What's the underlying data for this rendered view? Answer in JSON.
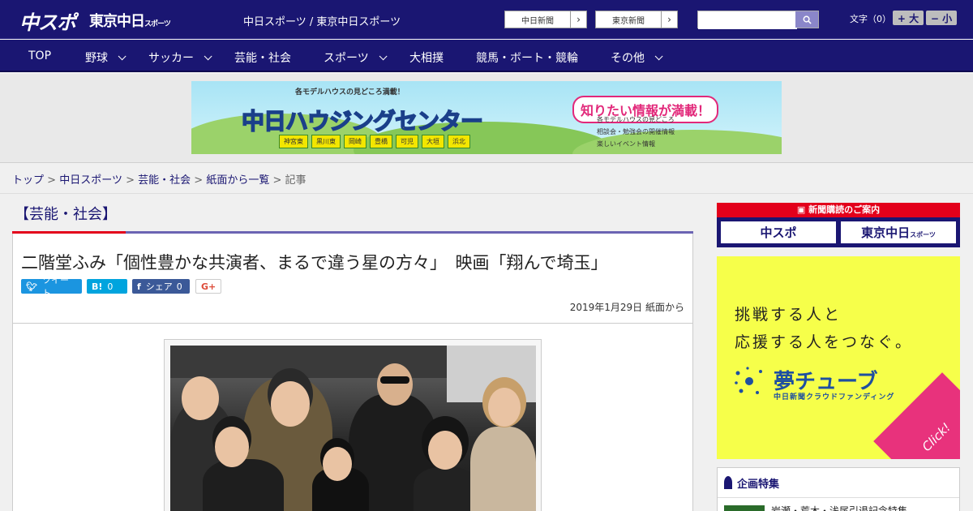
{
  "header": {
    "logo_main": "中スポ",
    "logo_sub": "東京中日",
    "logo_sub_small": "スポーツ",
    "site_name": "中日スポーツ / 東京中日スポーツ",
    "link_chunichi": "中日新聞",
    "link_tokyo": "東京新聞",
    "search_placeholder": "",
    "font_label": "文字（0）",
    "font_bigger": "+ 大",
    "font_smaller": "− 小"
  },
  "nav": {
    "items": [
      {
        "label": "TOP"
      },
      {
        "label": "野球"
      },
      {
        "label": "サッカー"
      },
      {
        "label": "芸能・社会"
      },
      {
        "label": "スポーツ"
      },
      {
        "label": "大相撲"
      },
      {
        "label": "競馬・ボート・競輪"
      },
      {
        "label": "その他"
      }
    ]
  },
  "banner": {
    "top_text": "各モデルハウスの見どころ満載！",
    "title": "中日ハウジングセンター",
    "tags": [
      "神宮東",
      "黒川東",
      "岡崎",
      "豊橋",
      "可児",
      "大垣",
      "浜北"
    ],
    "right_title": "知りたい情報が満載！",
    "list": [
      "各モデルハウスの見どころ",
      "相談会・勉強会の開催情報",
      "楽しいイベント情報"
    ]
  },
  "breadcrumb": {
    "items": [
      "トップ",
      "中日スポーツ",
      "芸能・社会",
      "紙面から一覧"
    ],
    "current": "記事",
    "sep": ">"
  },
  "article": {
    "category": "【芸能・社会】",
    "headline": "二階堂ふみ「個性豊かな共演者、まるで違う星の方々」　映画「翔んで埼玉」",
    "share": {
      "tweet": "ツイート",
      "hatena_count": "0",
      "hatena_icon": "B!",
      "facebook_label": "シェア",
      "facebook_count": "0",
      "gplus": "G+"
    },
    "date": "2019年1月29日 紙面から"
  },
  "sidebar": {
    "subscribe_strip": "新聞購読のご案内",
    "subscribe_a": "中スポ",
    "subscribe_b": "東京中日",
    "subscribe_b_small": "スポーツ",
    "ad_line1": "挑戦する人と",
    "ad_line2": "応援する人をつなぐ。",
    "ad_brand": "夢チューブ",
    "ad_brand_sub": "中日新聞クラウドファンディング",
    "ad_click": "Click!",
    "feature_title": "企画特集",
    "feature_item": "岩瀬・荒木・浅尾引退記念特集"
  },
  "colors": {
    "brand": "#1a1672",
    "accent_red": "#e3001b",
    "twitter": "#1b95e0",
    "hatena": "#00a4de",
    "facebook": "#3b5998"
  }
}
